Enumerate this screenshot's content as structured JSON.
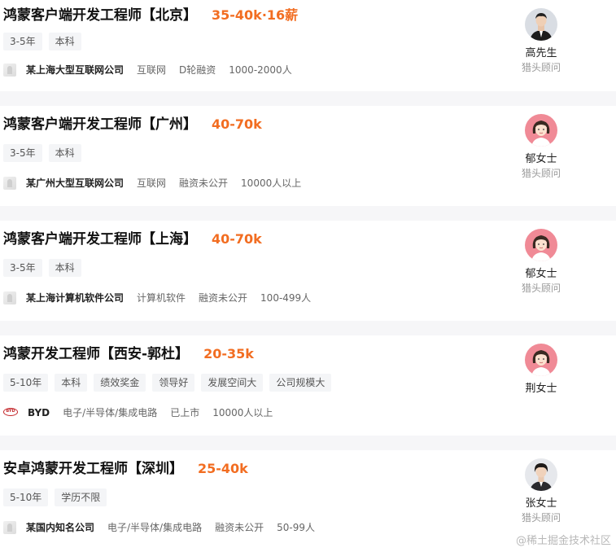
{
  "jobs": [
    {
      "title": "鸿蒙客户端开发工程师【北京】",
      "salary": "35-40k·16薪",
      "tags": [
        "3-5年",
        "本科"
      ],
      "company": {
        "name": "某上海大型互联网公司",
        "industry": "互联网",
        "funding": "D轮融资",
        "size": "1000-2000人"
      },
      "hunter": {
        "name": "高先生",
        "role": "猎头顾问"
      }
    },
    {
      "title": "鸿蒙客户端开发工程师【广州】",
      "salary": "40-70k",
      "tags": [
        "3-5年",
        "本科"
      ],
      "company": {
        "name": "某广州大型互联网公司",
        "industry": "互联网",
        "funding": "融资未公开",
        "size": "10000人以上"
      },
      "hunter": {
        "name": "郁女士",
        "role": "猎头顾问"
      }
    },
    {
      "title": "鸿蒙客户端开发工程师【上海】",
      "salary": "40-70k",
      "tags": [
        "3-5年",
        "本科"
      ],
      "company": {
        "name": "某上海计算机软件公司",
        "industry": "计算机软件",
        "funding": "融资未公开",
        "size": "100-499人"
      },
      "hunter": {
        "name": "郁女士",
        "role": "猎头顾问"
      }
    },
    {
      "title": "鸿蒙开发工程师【西安-郭杜】",
      "salary": "20-35k",
      "tags": [
        "5-10年",
        "本科",
        "绩效奖金",
        "领导好",
        "发展空间大",
        "公司规模大"
      ],
      "company": {
        "name": "BYD",
        "industry": "电子/半导体/集成电路",
        "funding": "已上市",
        "size": "10000人以上",
        "logo_text": "BYD"
      },
      "hunter": {
        "name": "荆女士",
        "role": ""
      }
    },
    {
      "title": "安卓鸿蒙开发工程师【深圳】",
      "salary": "25-40k",
      "tags": [
        "5-10年",
        "学历不限"
      ],
      "company": {
        "name": "某国内知名公司",
        "industry": "电子/半导体/集成电路",
        "funding": "融资未公开",
        "size": "50-99人"
      },
      "hunter": {
        "name": "张女士",
        "role": "猎头顾问"
      }
    }
  ],
  "watermark": "@稀土掘金技术社区",
  "colors": {
    "salary": "#f26d21",
    "gap": "#f6f6f8",
    "tag_bg": "#f4f5f7",
    "avatar_pink": "#f08a96"
  }
}
